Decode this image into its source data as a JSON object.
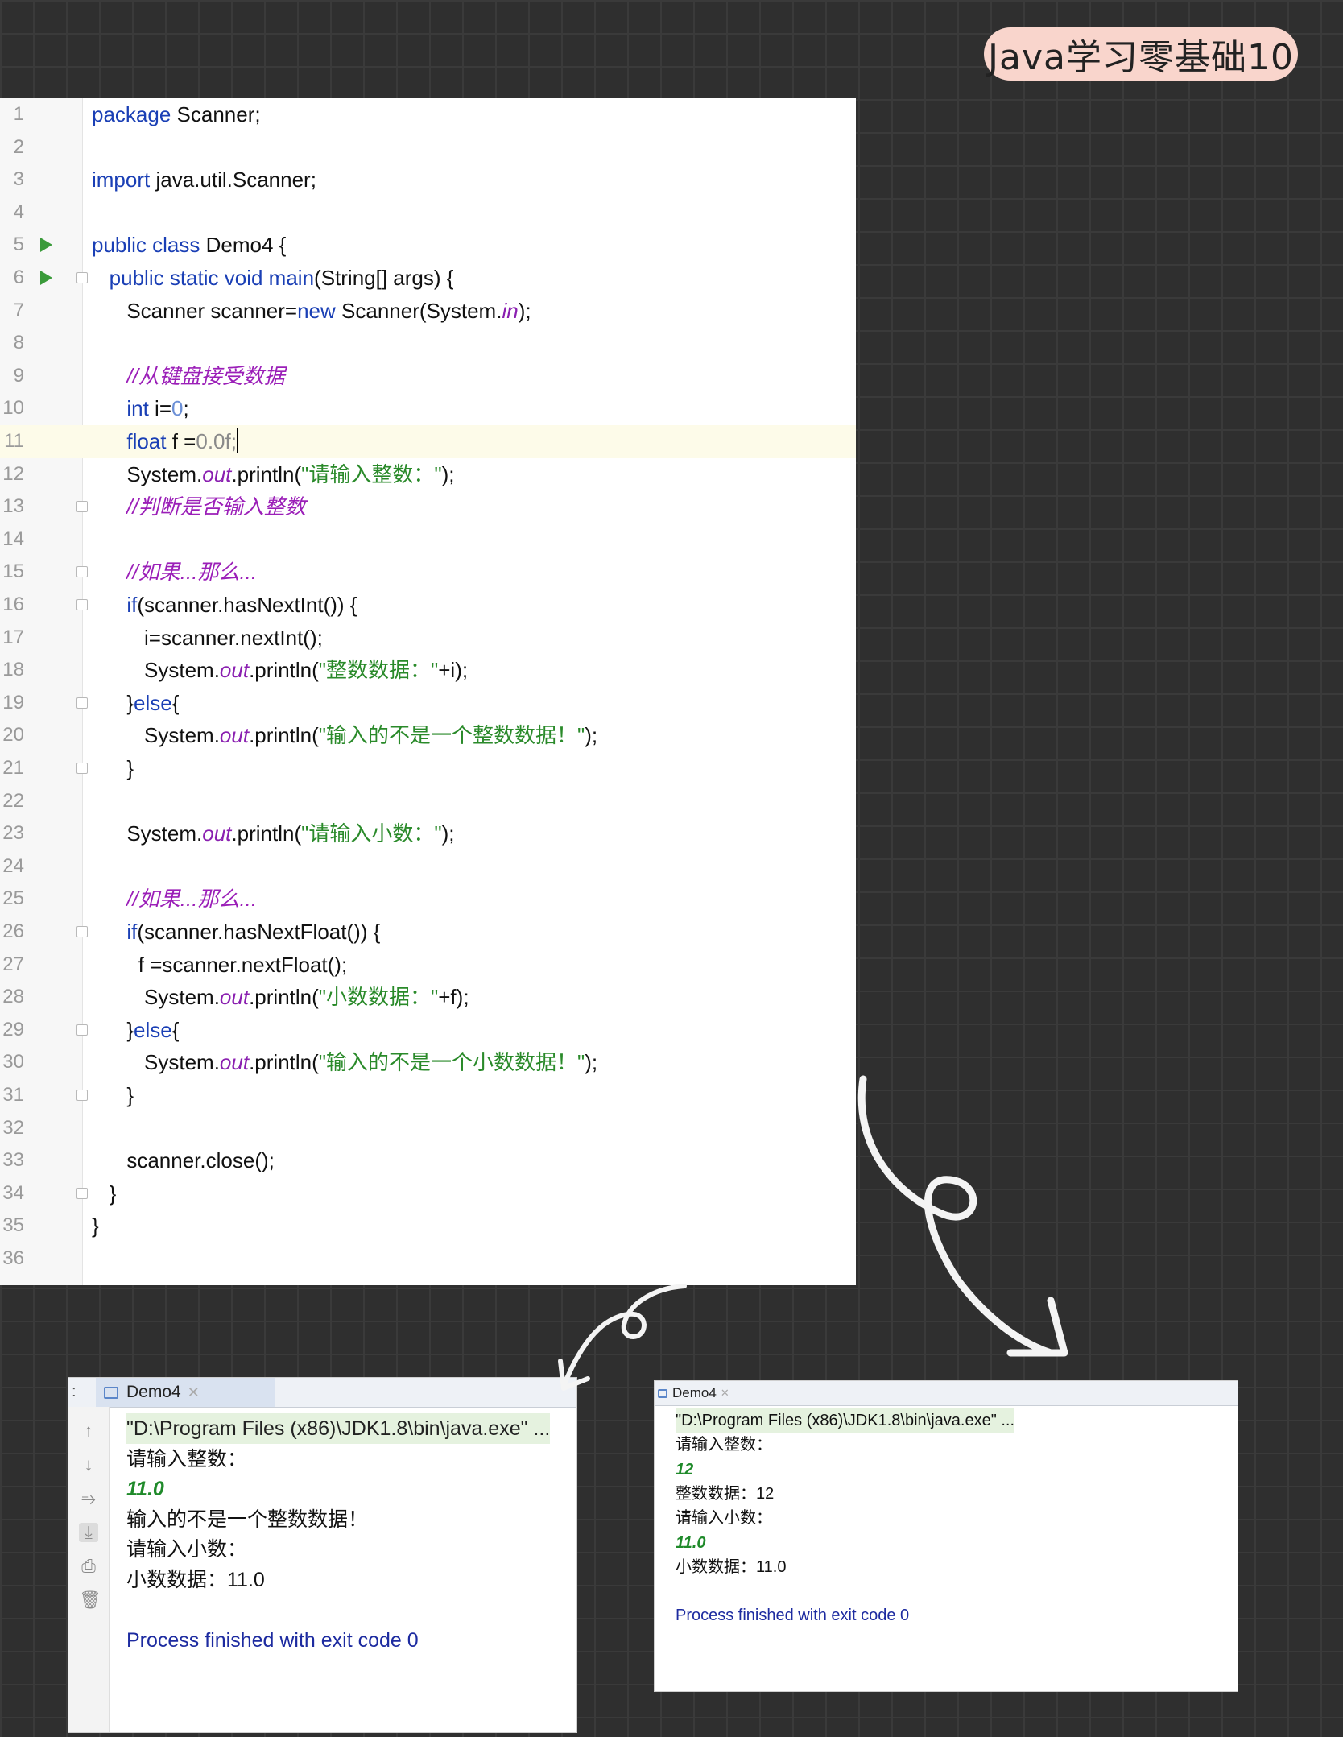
{
  "badge": "Java学习零基础10",
  "editor": {
    "lines": [
      {
        "n": "1",
        "html": "<span class=\"kw\">package</span> Scanner;"
      },
      {
        "n": "2",
        "html": ""
      },
      {
        "n": "3",
        "html": "<span class=\"kw\">import</span> java.util.Scanner;"
      },
      {
        "n": "4",
        "html": ""
      },
      {
        "n": "5",
        "html": "<span class=\"kw\">public class</span> Demo4 {",
        "run": true
      },
      {
        "n": "6",
        "html": "   <span class=\"kw\">public static void</span> <span class=\"kw\">main</span>(String[] args) {",
        "run": true,
        "fold": true
      },
      {
        "n": "7",
        "html": "      Scanner scanner=<span class=\"kw\">new</span> Scanner(System.<span class=\"field\">in</span>);"
      },
      {
        "n": "8",
        "html": ""
      },
      {
        "n": "9",
        "html": "      <span class=\"cmt\">//从键盘接受数据</span>"
      },
      {
        "n": "10",
        "html": "      <span class=\"kw\">int</span> i=<span class=\"num\">0</span>;"
      },
      {
        "n": "11",
        "html": "      <span class=\"kw\">float</span> f =<span class=\"numg\">0.0f;</span><span class=\"caret\"></span>",
        "current": true
      },
      {
        "n": "12",
        "html": "      System.<span class=\"field\">out</span>.println(<span class=\"str\">\"请输入整数：\"</span>);"
      },
      {
        "n": "13",
        "html": "      <span class=\"cmt\">//判断是否输入整数</span>",
        "fold": true
      },
      {
        "n": "14",
        "html": ""
      },
      {
        "n": "15",
        "html": "      <span class=\"cmt\">//如果...那么...</span>",
        "fold": true
      },
      {
        "n": "16",
        "html": "      <span class=\"kw\">if</span>(scanner.hasNextInt()) {",
        "fold": true
      },
      {
        "n": "17",
        "html": "         i=scanner.nextInt();"
      },
      {
        "n": "18",
        "html": "         System.<span class=\"field\">out</span>.println(<span class=\"str\">\"整数数据：\"</span>+i);"
      },
      {
        "n": "19",
        "html": "      }<span class=\"kw\">else</span>{",
        "fold": true
      },
      {
        "n": "20",
        "html": "         System.<span class=\"field\">out</span>.println(<span class=\"str\">\"输入的不是一个整数数据！\"</span>);"
      },
      {
        "n": "21",
        "html": "      }",
        "fold": true
      },
      {
        "n": "22",
        "html": ""
      },
      {
        "n": "23",
        "html": "      System.<span class=\"field\">out</span>.println(<span class=\"str\">\"请输入小数：\"</span>);"
      },
      {
        "n": "24",
        "html": ""
      },
      {
        "n": "25",
        "html": "      <span class=\"cmt\">//如果...那么...</span>"
      },
      {
        "n": "26",
        "html": "      <span class=\"kw\">if</span>(scanner.hasNextFloat()) {",
        "fold": true
      },
      {
        "n": "27",
        "html": "        f =scanner.nextFloat();"
      },
      {
        "n": "28",
        "html": "         System.<span class=\"field\">out</span>.println(<span class=\"str\">\"小数数据：\"</span>+f);"
      },
      {
        "n": "29",
        "html": "      }<span class=\"kw\">else</span>{",
        "fold": true
      },
      {
        "n": "30",
        "html": "         System.<span class=\"field\">out</span>.println(<span class=\"str\">\"输入的不是一个小数数据！\"</span>);"
      },
      {
        "n": "31",
        "html": "      }",
        "fold": true
      },
      {
        "n": "32",
        "html": ""
      },
      {
        "n": "33",
        "html": "      scanner.close();"
      },
      {
        "n": "34",
        "html": "   }",
        "fold": true
      },
      {
        "n": "35",
        "html": "}"
      },
      {
        "n": "36",
        "html": ""
      }
    ]
  },
  "console1": {
    "tab_label": "Demo4",
    "lines": [
      {
        "text": "\"D:\\Program Files (x86)\\JDK1.8\\bin\\java.exe\" ...",
        "kind": "cmd"
      },
      {
        "text": "请输入整数：",
        "kind": "out"
      },
      {
        "text": "11.0",
        "kind": "input"
      },
      {
        "text": "输入的不是一个整数数据！",
        "kind": "out"
      },
      {
        "text": "请输入小数：",
        "kind": "out"
      },
      {
        "text": "小数数据：11.0",
        "kind": "out"
      },
      {
        "text": "",
        "kind": "out"
      },
      {
        "text": "Process finished with exit code 0",
        "kind": "exit"
      }
    ],
    "icons": [
      "arrow-up-icon",
      "arrow-down-icon",
      "soft-wrap-icon",
      "scroll-to-end-icon",
      "print-icon",
      "trash-icon"
    ]
  },
  "console2": {
    "tab_label": "Demo4",
    "lines": [
      {
        "text": "\"D:\\Program Files (x86)\\JDK1.8\\bin\\java.exe\" ...",
        "kind": "cmd"
      },
      {
        "text": "请输入整数：",
        "kind": "out"
      },
      {
        "text": "12",
        "kind": "input"
      },
      {
        "text": "整数数据：12",
        "kind": "out"
      },
      {
        "text": "请输入小数：",
        "kind": "out"
      },
      {
        "text": "11.0",
        "kind": "input"
      },
      {
        "text": "小数数据：11.0",
        "kind": "out"
      },
      {
        "text": "",
        "kind": "out"
      },
      {
        "text": "Process finished with exit code 0",
        "kind": "exit"
      }
    ]
  }
}
